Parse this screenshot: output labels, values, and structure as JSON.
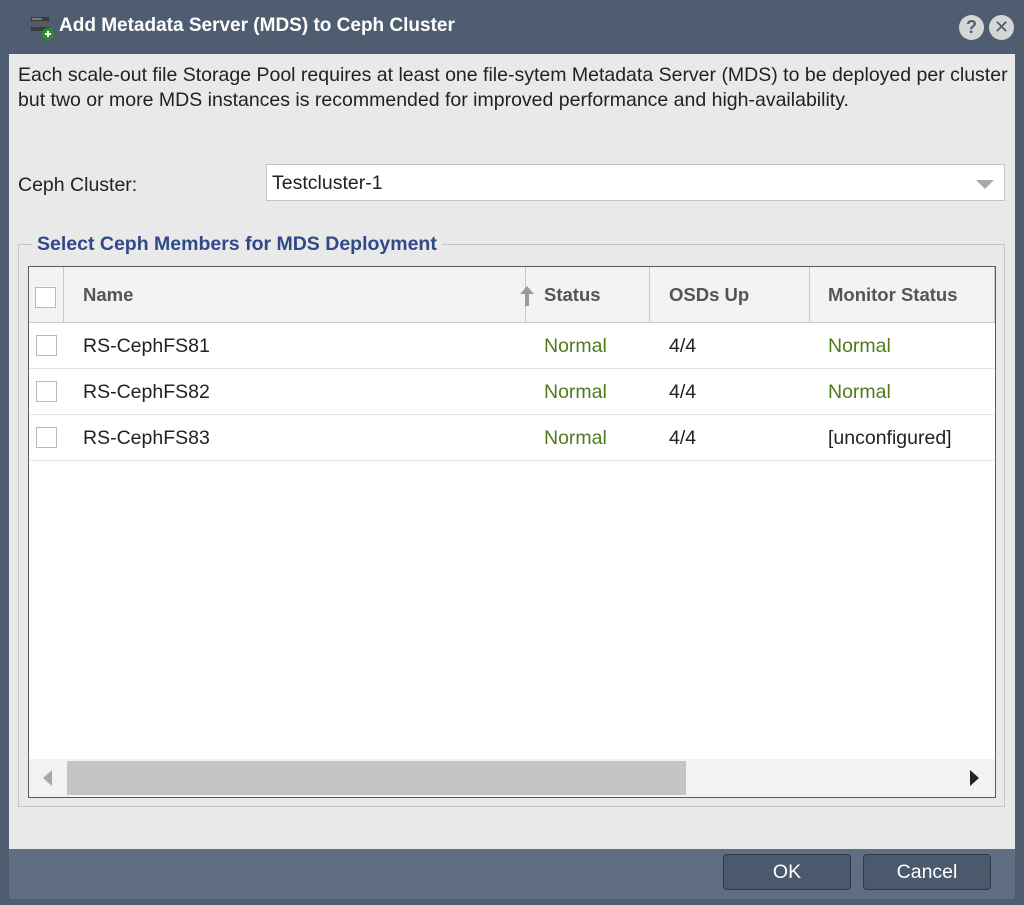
{
  "window": {
    "title": "Add Metadata Server (MDS) to Ceph Cluster",
    "help_label": "?",
    "close_label": "✕"
  },
  "description": "Each scale-out file Storage Pool requires at least one file-sytem Metadata Server (MDS) to be deployed per cluster but two or more MDS instances is recommended for improved performance and high-availability.",
  "cluster": {
    "label": "Ceph Cluster:",
    "value": "Testcluster-1"
  },
  "members_section": {
    "legend": "Select Ceph Members for MDS Deployment",
    "columns": {
      "name": "Name",
      "status": "Status",
      "osds_up": "OSDs Up",
      "monitor_status": "Monitor Status"
    },
    "sort": {
      "column": "Name",
      "direction": "ascending"
    },
    "rows": [
      {
        "name": "RS-CephFS81",
        "status": "Normal",
        "osds_up": "4/4",
        "monitor_status": "Normal"
      },
      {
        "name": "RS-CephFS82",
        "status": "Normal",
        "osds_up": "4/4",
        "monitor_status": "Normal"
      },
      {
        "name": "RS-CephFS83",
        "status": "Normal",
        "osds_up": "4/4",
        "monitor_status": "[unconfigured]"
      }
    ]
  },
  "buttons": {
    "ok": "OK",
    "cancel": "Cancel"
  },
  "colors": {
    "titlebar": "#4f5d70",
    "legend": "#2f4a8a",
    "status_normal": "#4f7a1c"
  }
}
